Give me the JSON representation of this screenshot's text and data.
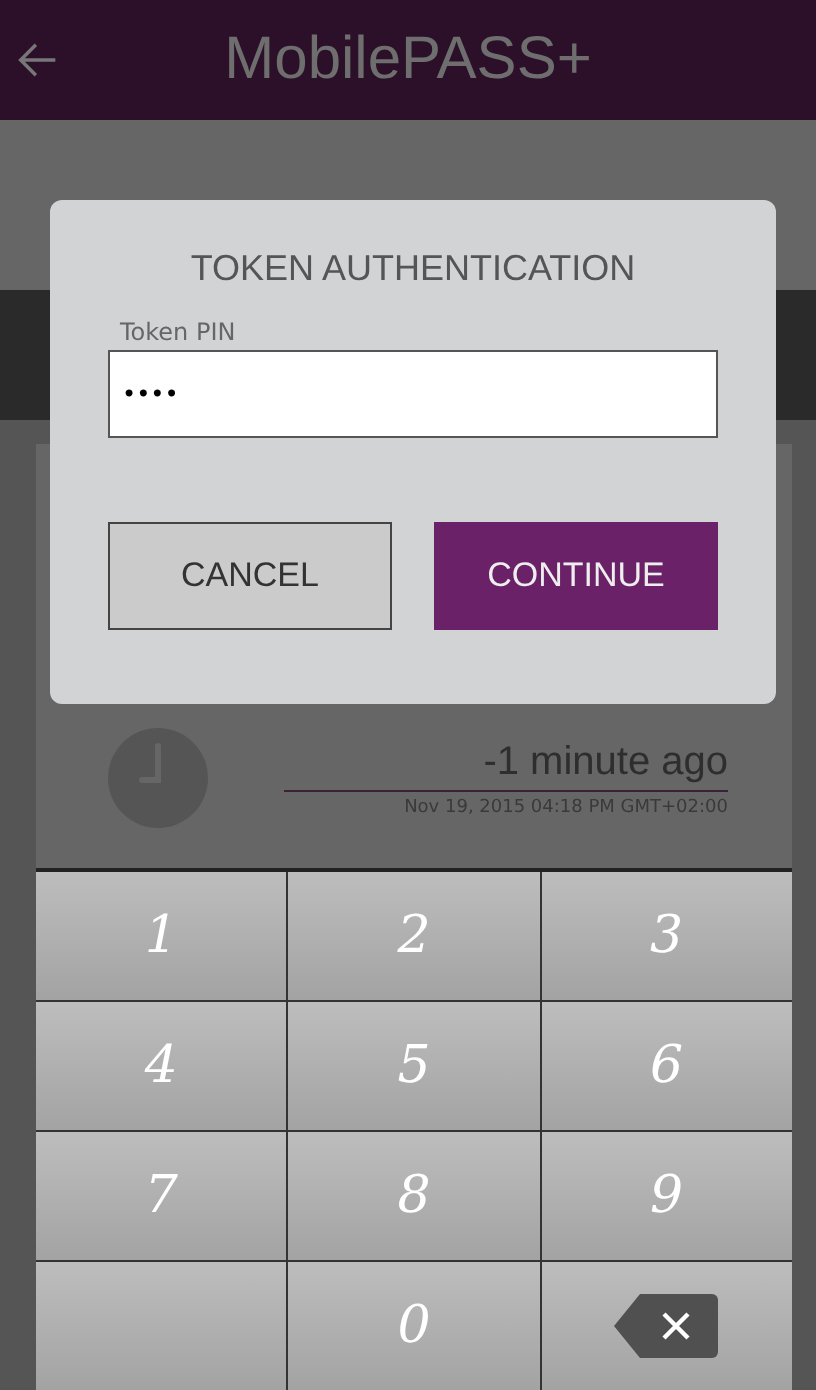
{
  "app_bar": {
    "title": "MobilePASS+"
  },
  "dialog": {
    "title": "TOKEN AUTHENTICATION",
    "field": {
      "label": "Token PIN",
      "value": "••••"
    },
    "buttons": [
      {
        "label": "CANCEL",
        "kind": "secondary"
      },
      {
        "label": "CONTINUE",
        "kind": "primary"
      }
    ]
  },
  "token": {
    "relative_time": "-1 minute ago",
    "timestamp": "Nov 19, 2015 04:18 PM GMT+02:00"
  },
  "keypad": [
    {
      "kind": "digit",
      "label": "1"
    },
    {
      "kind": "digit",
      "label": "2"
    },
    {
      "kind": "digit",
      "label": "3"
    },
    {
      "kind": "digit",
      "label": "4"
    },
    {
      "kind": "digit",
      "label": "5"
    },
    {
      "kind": "digit",
      "label": "6"
    },
    {
      "kind": "digit",
      "label": "7"
    },
    {
      "kind": "digit",
      "label": "8"
    },
    {
      "kind": "digit",
      "label": "9"
    },
    {
      "kind": "blank"
    },
    {
      "kind": "digit",
      "label": "0"
    },
    {
      "kind": "backspace"
    }
  ]
}
